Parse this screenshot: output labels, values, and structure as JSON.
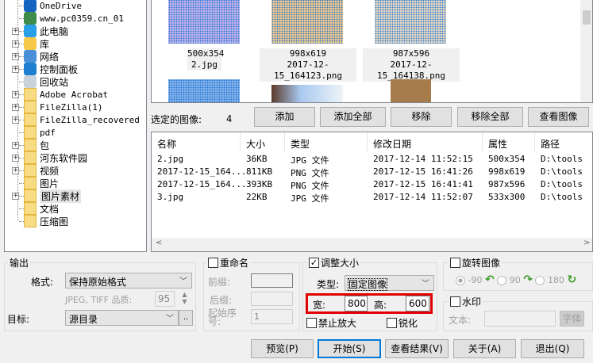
{
  "tree": {
    "items": [
      {
        "label": "OneDrive",
        "expandable": false,
        "icon": "onedrive-icon"
      },
      {
        "label": "www.pc0359.cn_01",
        "expandable": false,
        "icon": "user-icon"
      },
      {
        "label": "此电脑",
        "expandable": true,
        "icon": "computer-icon"
      },
      {
        "label": "库",
        "expandable": true,
        "icon": "library-icon"
      },
      {
        "label": "网络",
        "expandable": true,
        "icon": "network-icon"
      },
      {
        "label": "控制面板",
        "expandable": true,
        "icon": "control-panel-icon"
      },
      {
        "label": "回收站",
        "expandable": false,
        "icon": "recycle-bin-icon"
      },
      {
        "label": "Adobe Acrobat",
        "expandable": true,
        "icon": "folder-icon"
      },
      {
        "label": "FileZilla(1)",
        "expandable": true,
        "icon": "folder-icon"
      },
      {
        "label": "FileZilla_recovered",
        "expandable": true,
        "icon": "folder-icon"
      },
      {
        "label": "pdf",
        "expandable": false,
        "icon": "folder-icon"
      },
      {
        "label": "包",
        "expandable": true,
        "icon": "folder-icon"
      },
      {
        "label": "河东软件园",
        "expandable": true,
        "icon": "folder-icon"
      },
      {
        "label": "视频",
        "expandable": true,
        "icon": "folder-icon"
      },
      {
        "label": "图片",
        "expandable": false,
        "icon": "folder-icon"
      },
      {
        "label": "图片素材",
        "expandable": true,
        "icon": "folder-icon",
        "selected": true
      },
      {
        "label": "文档",
        "expandable": false,
        "icon": "folder-icon"
      },
      {
        "label": "压缩图",
        "expandable": false,
        "icon": "folder-icon"
      }
    ]
  },
  "thumbnails": [
    {
      "dims": "500x354",
      "name": "2.jpg"
    },
    {
      "dims": "998x619",
      "name": "2017-12-15_164123.png"
    },
    {
      "dims": "987x596",
      "name": "2017-12-15_164138.png"
    }
  ],
  "toolbar": {
    "selected_label": "选定的图像:",
    "selected_count": "4",
    "add": "添加",
    "add_all": "添加全部",
    "remove": "移除",
    "remove_all": "移除全部",
    "view": "查看图像"
  },
  "list": {
    "columns": [
      "名称",
      "大小",
      "类型",
      "修改日期",
      "属性",
      "路径"
    ],
    "rows": [
      [
        "2.jpg",
        "36KB",
        "JPG 文件",
        "2017-12-14 11:52:15",
        "500x354",
        "D:\\tools"
      ],
      [
        "2017-12-15_164...",
        "811KB",
        "PNG 文件",
        "2017-12-15 16:41:26",
        "998x619",
        "D:\\tools"
      ],
      [
        "2017-12-15_164...",
        "393KB",
        "PNG 文件",
        "2017-12-15 16:41:41",
        "987x596",
        "D:\\tools"
      ],
      [
        "3.jpg",
        "22KB",
        "JPG 文件",
        "2017-12-14 11:52:07",
        "533x300",
        "D:\\tools"
      ]
    ]
  },
  "output": {
    "title": "输出",
    "format_label": "格式:",
    "format_value": "保持原始格式",
    "quality_label": "JPEG, TIFF 品质:",
    "quality_value": "95",
    "target_label": "目标:",
    "target_value": "源目录",
    "browse": ".."
  },
  "rename": {
    "title": "重命名",
    "checked": false,
    "prefix_label": "前缀:",
    "suffix_label": "后缀:",
    "start_label": "起始序号:",
    "start_value": "1"
  },
  "resize": {
    "title": "调整大小",
    "checked": true,
    "type_label": "类型:",
    "type_value": "固定图像",
    "width_label": "宽:",
    "width_value": "800",
    "height_label": "高:",
    "height_value": "600",
    "no_enlarge": "禁止放大",
    "sharpen": "锐化"
  },
  "rotate": {
    "title": "旋转图像",
    "checked": false,
    "options": [
      "-90",
      "90",
      "180"
    ]
  },
  "watermark": {
    "title": "水印",
    "checked": false,
    "text_label": "文本:",
    "font_button": "字体"
  },
  "buttons": {
    "preview": "预览(P)",
    "start": "开始(S)",
    "view_result": "查看结果(V)",
    "about": "关于(A)",
    "exit": "退出(Q)"
  },
  "colors": {
    "highlight": "#e00000",
    "focus": "#0078d7"
  }
}
